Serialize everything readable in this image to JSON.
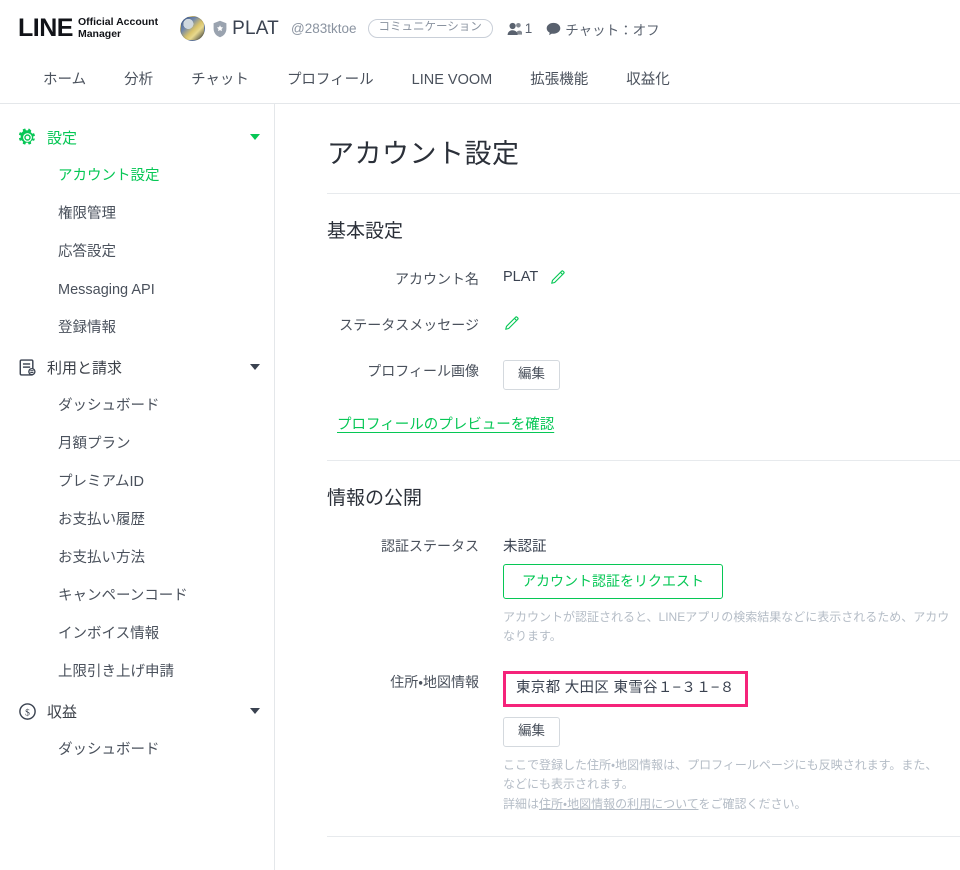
{
  "header": {
    "logo_word": "LINE",
    "logo_sub": "Official Account\nManager",
    "avatar_icon": "account-avatar-image",
    "shield_icon": "shield-badge-icon",
    "account_name": "PLAT",
    "account_id": "@283tktoe",
    "category_pill": "コミュニケーション",
    "friends_icon": "friends-icon",
    "friends_count": "1",
    "chat_icon": "chat-bubble-icon",
    "chat_status": "チャット：オフ"
  },
  "nav": {
    "tabs": [
      {
        "label": "ホーム",
        "name": "tab-home"
      },
      {
        "label": "分析",
        "name": "tab-analytics"
      },
      {
        "label": "チャット",
        "name": "tab-chat"
      },
      {
        "label": "プロフィール",
        "name": "tab-profile"
      },
      {
        "label": "LINE VOOM",
        "name": "tab-line-voom"
      },
      {
        "label": "拡張機能",
        "name": "tab-extensions"
      },
      {
        "label": "収益化",
        "name": "tab-monetization"
      }
    ]
  },
  "sidebar": {
    "groups": [
      {
        "label": "設定",
        "icon": "gear-icon",
        "active": true,
        "items": [
          {
            "label": "アカウント設定",
            "active": true
          },
          {
            "label": "権限管理",
            "active": false
          },
          {
            "label": "応答設定",
            "active": false
          },
          {
            "label": "Messaging API",
            "active": false
          },
          {
            "label": "登録情報",
            "active": false
          }
        ]
      },
      {
        "label": "利用と請求",
        "icon": "invoice-icon",
        "active": false,
        "items": [
          {
            "label": "ダッシュボード",
            "active": false
          },
          {
            "label": "月額プラン",
            "active": false
          },
          {
            "label": "プレミアムID",
            "active": false
          },
          {
            "label": "お支払い履歴",
            "active": false
          },
          {
            "label": "お支払い方法",
            "active": false
          },
          {
            "label": "キャンペーンコード",
            "active": false
          },
          {
            "label": "インボイス情報",
            "active": false
          },
          {
            "label": "上限引き上げ申請",
            "active": false
          }
        ]
      },
      {
        "label": "収益",
        "icon": "dollar-circle-icon",
        "active": false,
        "items": [
          {
            "label": "ダッシュボード",
            "active": false
          }
        ]
      }
    ]
  },
  "main": {
    "page_title": "アカウント設定",
    "basic": {
      "section_title": "基本設定",
      "account_name_label": "アカウント名",
      "account_name_value": "PLAT",
      "account_name_edit_icon": "pencil-edit-icon",
      "status_message_label": "ステータスメッセージ",
      "status_message_edit_icon": "pencil-edit-icon",
      "profile_image_label": "プロフィール画像",
      "profile_image_button": "編集",
      "preview_link": "プロフィールのプレビューを確認"
    },
    "disclosure": {
      "section_title": "情報の公開",
      "auth_status_label": "認証ステータス",
      "auth_status_value": "未認証",
      "auth_request_button": "アカウント認証をリクエスト",
      "auth_helper": "アカウントが認証されると、LINEアプリの検索結果などに表示されるため、アカウなります。",
      "address_label": "住所・地図情報",
      "address_value": "東京都 大田区 東雪谷１−３１−８",
      "address_edit_button": "編集",
      "address_helper_line1": "ここで登録した住所・地図情報は、プロフィールページにも反映されます。また、",
      "address_helper_line2": "などにも表示されます。",
      "address_helper_line3_prefix": "詳細は",
      "address_helper_link": "住所・地図情報の利用について",
      "address_helper_line3_suffix": "をご確認ください。"
    }
  },
  "colors": {
    "line_green": "#06C755",
    "highlight_pink": "#F5237A",
    "text_primary": "#3A4250",
    "text_muted": "#B4BCC6",
    "border": "#E4E7EA"
  }
}
